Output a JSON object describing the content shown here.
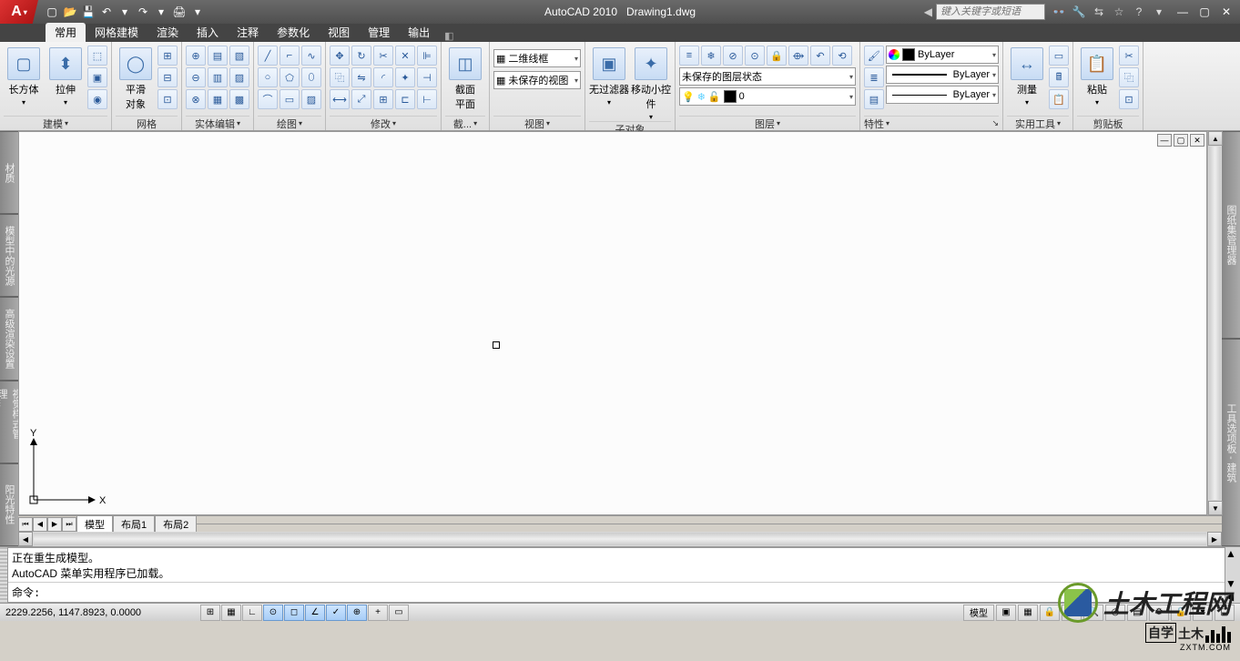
{
  "title": {
    "app": "AutoCAD 2010",
    "doc": "Drawing1.dwg"
  },
  "search_placeholder": "键入关键字或短语",
  "menu": {
    "tabs": [
      "常用",
      "网格建模",
      "渲染",
      "插入",
      "注释",
      "参数化",
      "视图",
      "管理",
      "输出"
    ]
  },
  "ribbon": {
    "p1": {
      "title": "建模",
      "b1": "长方体",
      "b2": "拉伸",
      "b3": "平滑\n对象"
    },
    "p2": {
      "title": "网格"
    },
    "p3": {
      "title": "实体编辑"
    },
    "p4": {
      "title": "绘图"
    },
    "p5": {
      "title": "修改"
    },
    "p6": {
      "title": "截...",
      "b1": "截面\n平面"
    },
    "p7": {
      "title": "视图",
      "d1": "二维线框",
      "d2": "未保存的视图"
    },
    "p8": {
      "title": "子对象",
      "b1": "无过滤器",
      "b2": "移动小控件"
    },
    "p9": {
      "title": "图层",
      "d1": "未保存的图层状态",
      "d2": "0"
    },
    "p10": {
      "title": "特性",
      "d1": "ByLayer",
      "d2": "ByLayer",
      "d3": "ByLayer"
    },
    "p11": {
      "title": "实用工具",
      "b1": "测量"
    },
    "p12": {
      "title": "剪贴板",
      "b1": "粘贴"
    }
  },
  "left_panels": [
    "材质",
    "模型中的光源",
    "高级渲染设置",
    "视觉样式管理...",
    "阳光特性"
  ],
  "right_panels": [
    "图纸集管理器",
    "工具选项板 - 建筑"
  ],
  "layout": {
    "tabs": [
      "模型",
      "布局1",
      "布局2"
    ]
  },
  "axes": {
    "x": "X",
    "y": "Y"
  },
  "command": {
    "history1": "正在重生成模型。",
    "history2": "AutoCAD 菜单实用程序已加载。",
    "prompt": "命令:"
  },
  "status": {
    "coords": "2229.2256, 1147.8923, 0.0000",
    "model_label": "模型"
  },
  "watermark": {
    "main": "土木工程网",
    "sub1": "自学",
    "sub2": "土木",
    "url": "ZXTM.COM"
  }
}
